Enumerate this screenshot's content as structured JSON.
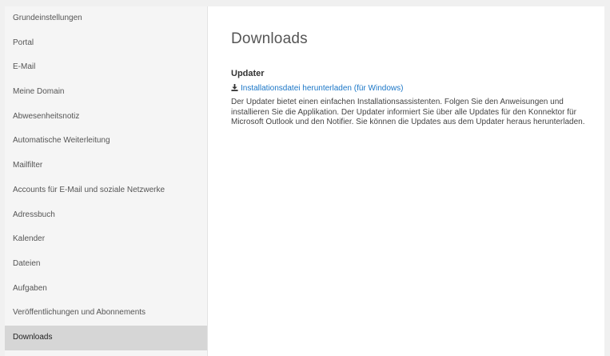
{
  "sidebar": {
    "items": [
      {
        "label": "Grundeinstellungen"
      },
      {
        "label": "Portal"
      },
      {
        "label": "E-Mail"
      },
      {
        "label": "Meine Domain"
      },
      {
        "label": "Abwesenheitsnotiz"
      },
      {
        "label": "Automatische Weiterleitung"
      },
      {
        "label": "Mailfilter"
      },
      {
        "label": "Accounts für E-Mail und soziale Netzwerke"
      },
      {
        "label": "Adressbuch"
      },
      {
        "label": "Kalender"
      },
      {
        "label": "Dateien"
      },
      {
        "label": "Aufgaben"
      },
      {
        "label": "Veröffentlichungen und Abonnements"
      },
      {
        "label": "Downloads"
      }
    ],
    "active_item": "Downloads"
  },
  "main": {
    "title": "Downloads",
    "section": {
      "heading": "Updater",
      "link_label": "Installationsdatei herunterladen (für Windows)",
      "link_icon": "download-icon",
      "description": "Der Updater bietet einen einfachen Installationsassistenten. Folgen Sie den Anweisungen und installieren Sie die Applikation. Der Updater informiert Sie über alle Updates für den Konnektor für Microsoft Outlook und den Notifier. Sie können die Updates aus dem Updater heraus herunterladen."
    }
  },
  "colors": {
    "link": "#1a76c7",
    "sidebar_background": "#f5f5f5",
    "sidebar_active": "#d6d6d6",
    "page_background": "#ffffff"
  }
}
